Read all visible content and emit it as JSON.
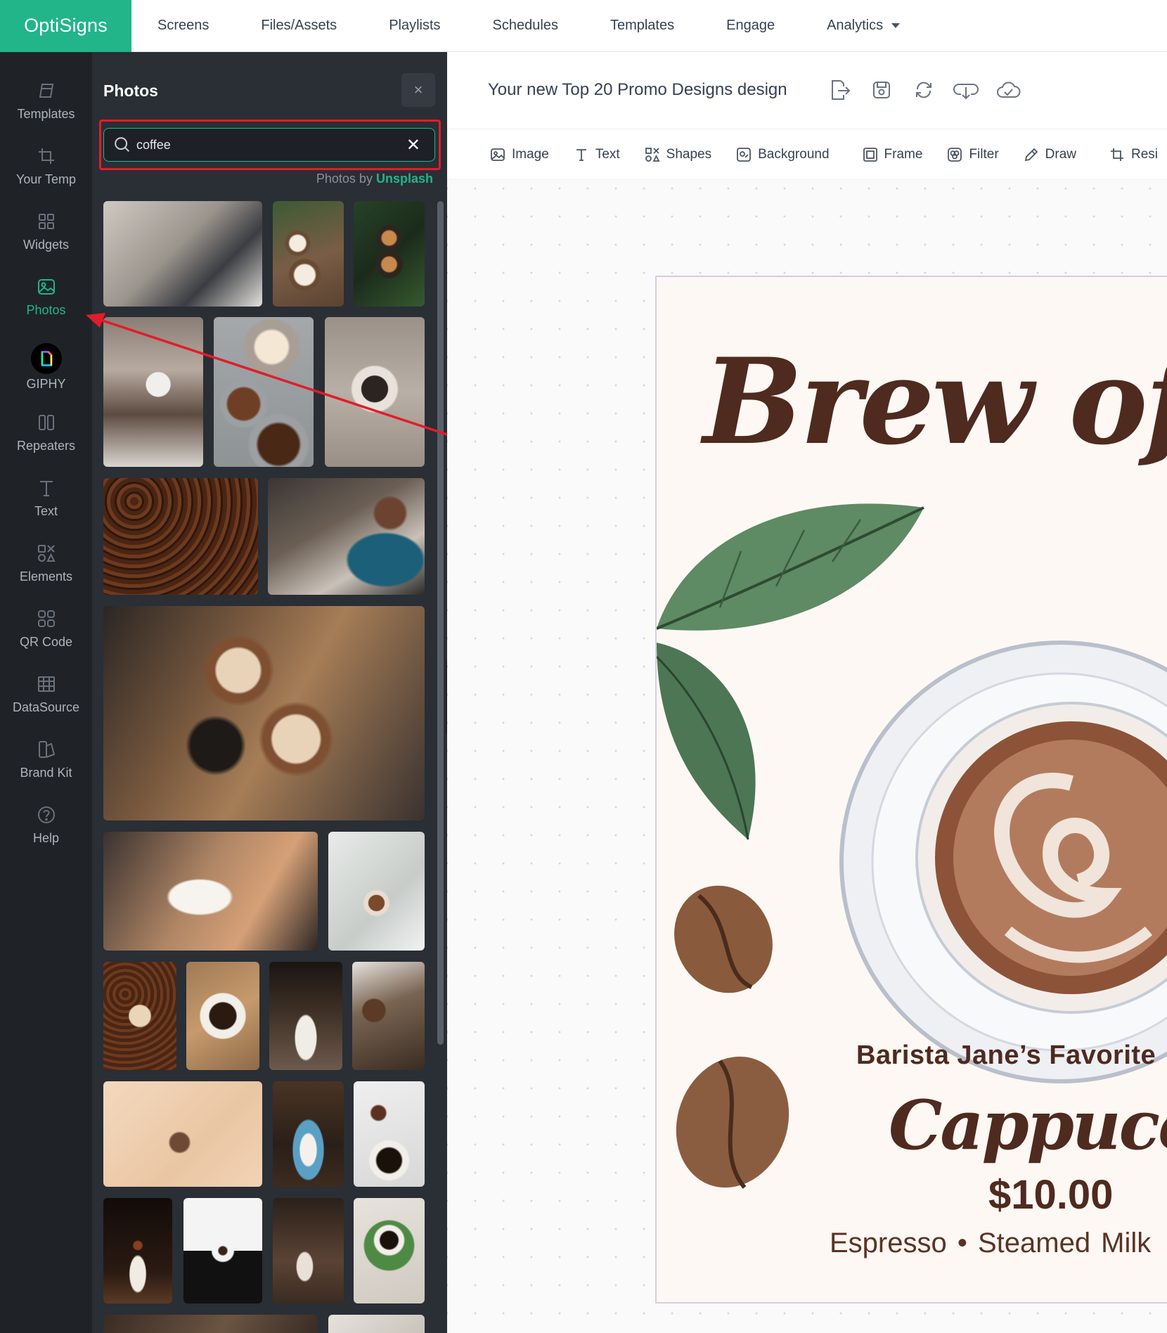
{
  "brand": "OptiSigns",
  "nav": {
    "items": [
      "Screens",
      "Files/Assets",
      "Playlists",
      "Schedules",
      "Templates",
      "Engage"
    ],
    "analytics": "Analytics"
  },
  "rail": {
    "templates": "Templates",
    "your_templates": "Your Temp",
    "widgets": "Widgets",
    "photos": "Photos",
    "giphy": "GIPHY",
    "repeaters": "Repeaters",
    "text": "Text",
    "elements": "Elements",
    "qr_code": "QR Code",
    "datasource": "DataSource",
    "brand_kit": "Brand Kit",
    "help": "Help"
  },
  "panel": {
    "title": "Photos",
    "close": "×",
    "search_value": "coffee",
    "clear": "✕",
    "credit_prefix": "Photos by",
    "credit_source": "Unsplash"
  },
  "editor": {
    "design_title": "Your new Top 20 Promo Designs design",
    "toolbar": {
      "image": "Image",
      "text": "Text",
      "shapes": "Shapes",
      "background": "Background",
      "frame": "Frame",
      "filter": "Filter",
      "draw": "Draw",
      "resize": "Resi"
    }
  },
  "design": {
    "headline": "Brew of t",
    "subtitle": "Barista Jane’s Favorite",
    "product": "Cappuccin",
    "price": "$10.00",
    "ingredients": "Espresso  •  Steamed Milk"
  },
  "colors": {
    "accent": "#22b58a",
    "rail_bg": "#1f2328",
    "panel_bg": "#2a2e35",
    "highlight": "#e11d2a",
    "design_brown": "#4f2a1f"
  }
}
